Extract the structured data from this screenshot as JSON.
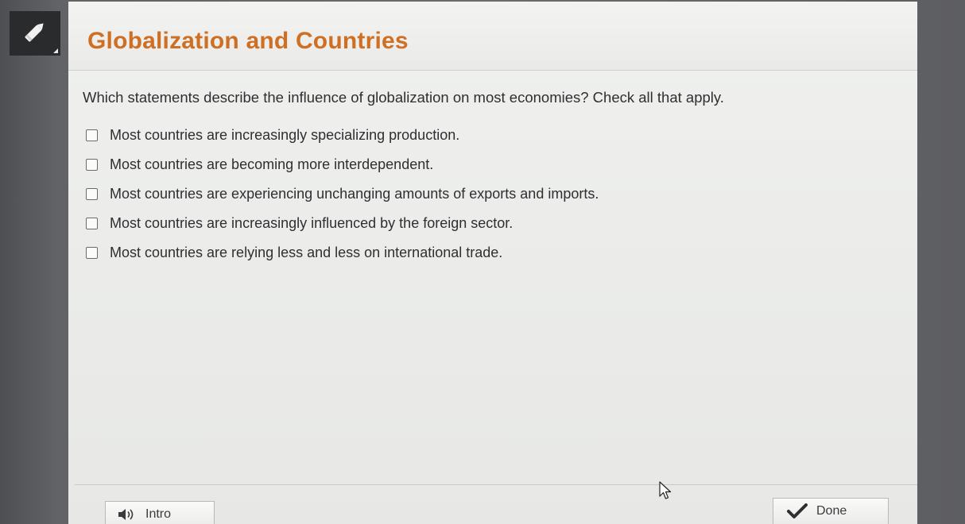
{
  "tool_icon": "pencil-icon",
  "title": "Globalization and Countries",
  "question": "Which statements describe the influence of globalization on most economies? Check all that apply.",
  "options": [
    {
      "label": "Most countries are increasingly specializing production.",
      "checked": false
    },
    {
      "label": "Most countries are becoming more interdependent.",
      "checked": false
    },
    {
      "label": "Most countries are experiencing unchanging amounts of exports and imports.",
      "checked": false
    },
    {
      "label": "Most countries are increasingly influenced by the foreign sector.",
      "checked": false
    },
    {
      "label": "Most countries are relying less and less on international trade.",
      "checked": false
    }
  ],
  "footer": {
    "intro_label": "Intro",
    "intro_icon": "speaker-icon",
    "done_label": "Done",
    "done_icon": "checkmark-icon"
  },
  "colors": {
    "title": "#cf6f24",
    "panel": "#eceded",
    "background": "#5e5f62",
    "badge": "#2a2b2d"
  }
}
